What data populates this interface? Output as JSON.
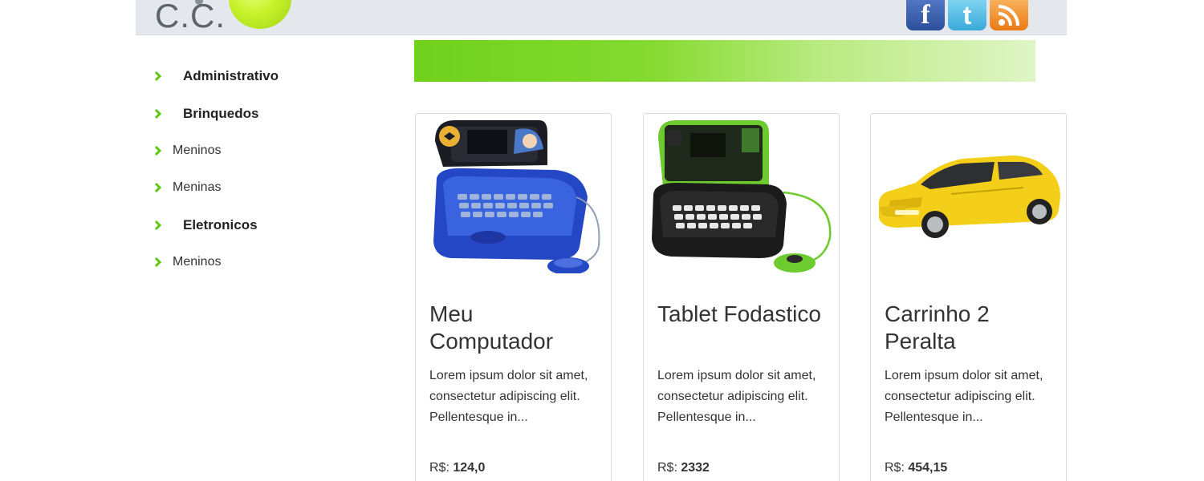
{
  "header": {
    "logo_text": "C.C.",
    "social": [
      {
        "name": "facebook",
        "glyph": "f",
        "color": "#3b5998"
      },
      {
        "name": "twitter",
        "glyph": "t",
        "color": "#4bb8e5"
      },
      {
        "name": "rss",
        "glyph": "rss",
        "color": "#f08a24"
      }
    ]
  },
  "sidebar": {
    "items": [
      {
        "label": "Administrativo",
        "type": "category"
      },
      {
        "label": "Brinquedos",
        "type": "category"
      },
      {
        "label": "Meninos",
        "type": "subcategory"
      },
      {
        "label": "Meninas",
        "type": "subcategory"
      },
      {
        "label": "Eletronicos",
        "type": "category"
      },
      {
        "label": "Meninos",
        "type": "subcategory"
      }
    ],
    "chevron_color": "#5cc80e"
  },
  "banner": {
    "color_start": "#6fd21b",
    "color_end": "#dff5c6"
  },
  "products": [
    {
      "title": "Meu Computador",
      "description": "Lorem ipsum dolor sit amet, consectetur adipiscing elit. Pellentesque in...",
      "price_label": "R$:",
      "price_value": "124,0",
      "image": "blue-batman-toy-laptop"
    },
    {
      "title": "Tablet Fodastico",
      "description": "Lorem ipsum dolor sit amet, consectetur adipiscing elit. Pellentesque in...",
      "price_label": "R$:",
      "price_value": "2332",
      "image": "black-green-ben10-toy-laptop"
    },
    {
      "title": "Carrinho 2 Peralta",
      "description": "Lorem ipsum dolor sit amet, consectetur adipiscing elit. Pellentesque in...",
      "price_label": "R$:",
      "price_value": "454,15",
      "image": "yellow-toy-sports-car"
    }
  ]
}
